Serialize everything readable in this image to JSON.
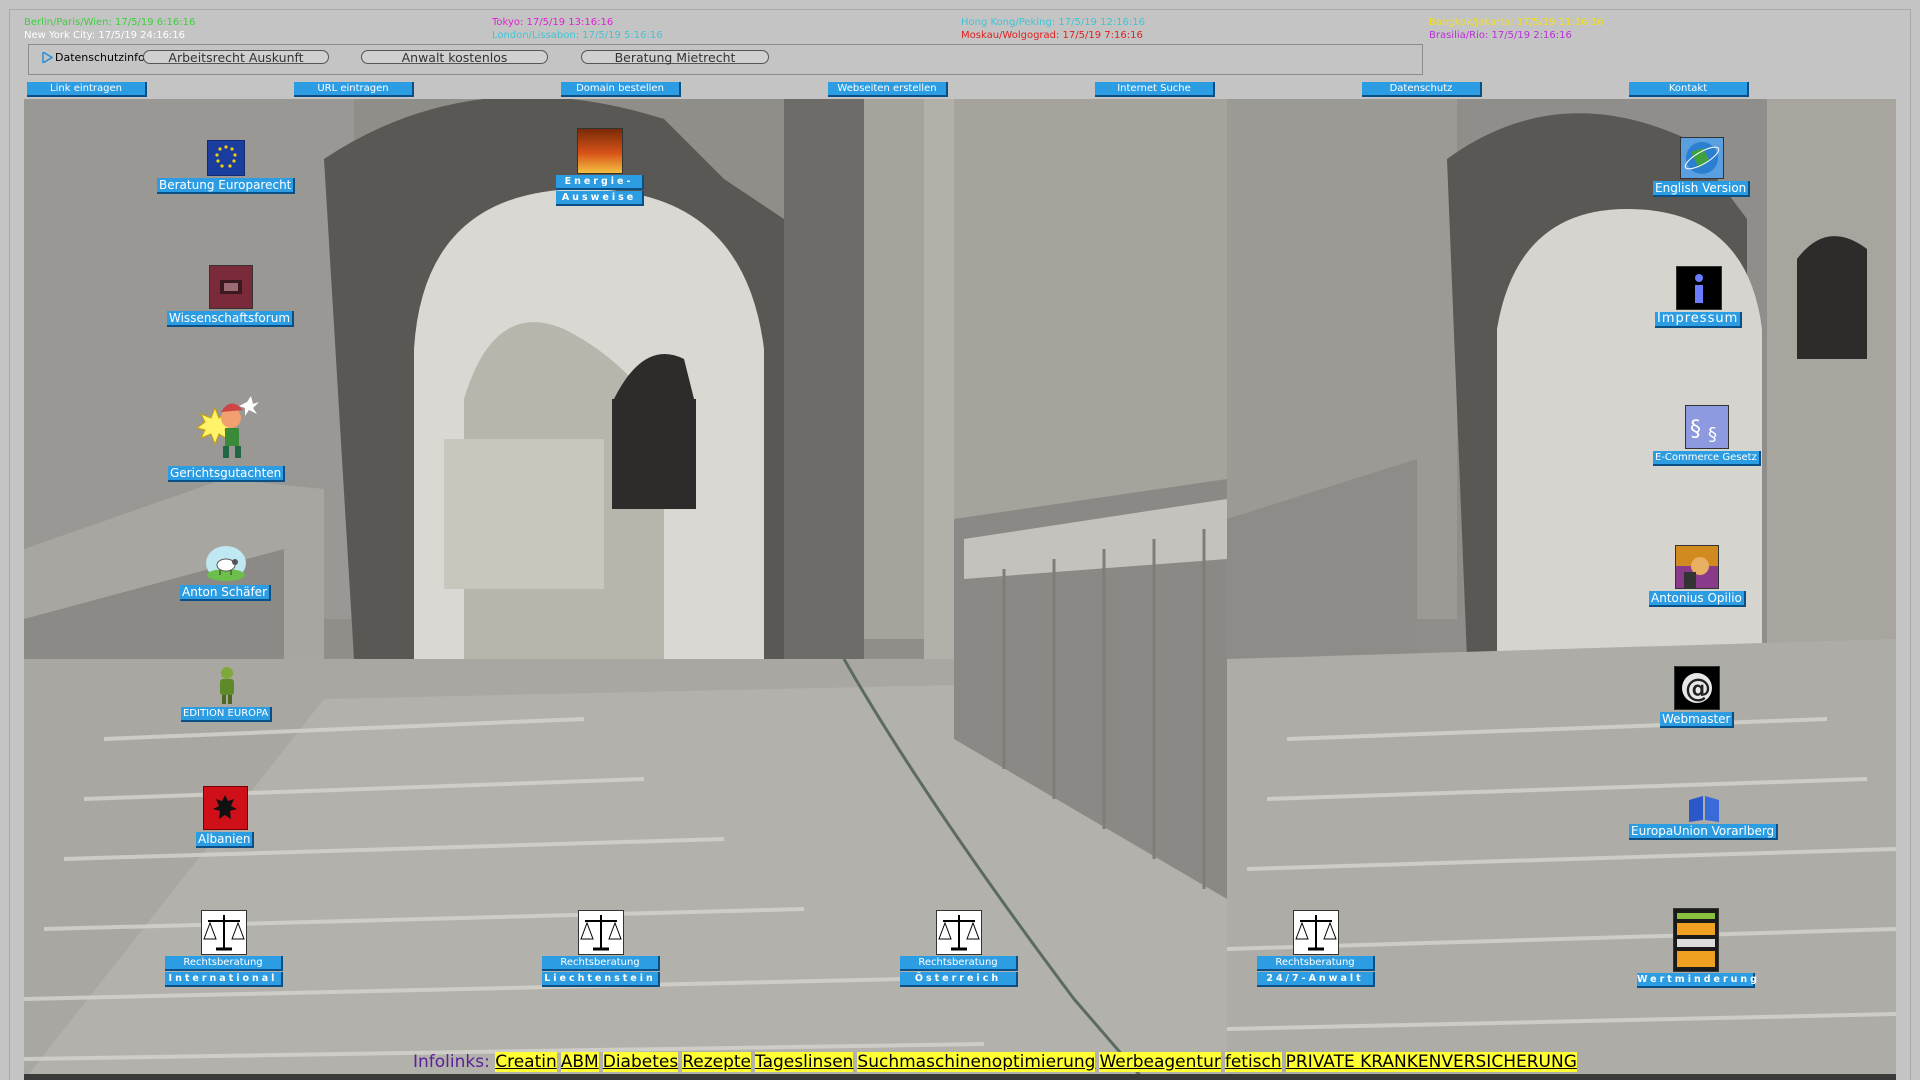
{
  "clocks": [
    {
      "text": "Berlin/Paris/Wien: 17/5/19 6:16:16",
      "color": "#3ecf3e"
    },
    {
      "text": "New York City: 17/5/19 24:16:16",
      "color": "#ffffff"
    },
    {
      "text": "Tokyo: 17/5/19 13:16:16",
      "color": "#e21fd6"
    },
    {
      "text": "London/Lissabon: 17/5/19 5:16:16",
      "color": "#3cc6d6"
    },
    {
      "text": "Hong Kong/Peking: 17/5/19 12:16:16",
      "color": "#3cc6d6"
    },
    {
      "text": "Moskau/Wolgograd: 17/5/19 7:16:16",
      "color": "#e21f1f"
    },
    {
      "text": "Bangkok/Jakarta: 17/5/19 11:16:16",
      "color": "#f0e020"
    },
    {
      "text": "Brasilia/Rio: 17/5/19 2:16:16",
      "color": "#b830d6"
    }
  ],
  "ad": {
    "privacy_label": "Datenschutzinfo",
    "pills": [
      "Arbeitsrecht Auskunft",
      "Anwalt kostenlos",
      "Beratung Mietrecht"
    ]
  },
  "nav": [
    "Link eintragen",
    "URL eintragen",
    "Domain bestellen",
    "Webseiten erstellen",
    "Internet Suche",
    "Datenschutz",
    "Kontakt"
  ],
  "left_icons": [
    {
      "label": "Beratung Europarecht",
      "icon": "eu-flag-icon"
    },
    {
      "label": "Wissenschaftsforum",
      "icon": "forum-icon"
    },
    {
      "label": "Gerichtsgutachten",
      "icon": "cartoon-figure-icon"
    },
    {
      "label": "Anton Schäfer",
      "icon": "sheep-icon"
    },
    {
      "label": "EDITION EUROPA",
      "icon": "figure-icon"
    },
    {
      "label": "Albanien",
      "icon": "albania-flag-icon"
    }
  ],
  "energy": {
    "line1": "Energie-",
    "line2": "Ausweise"
  },
  "right_icons": [
    {
      "label": "English Version",
      "icon": "globe-icon"
    },
    {
      "label": "Impressum",
      "icon": "info-icon"
    },
    {
      "label": "E-Commerce Gesetz",
      "icon": "paragraph-icon"
    },
    {
      "label": "Antonius Opilio",
      "icon": "portrait-icon"
    },
    {
      "label": "Webmaster",
      "icon": "at-sign-icon"
    },
    {
      "label": "EuropaUnion Vorarlberg",
      "icon": "book-icon"
    }
  ],
  "legal": [
    {
      "top": "Rechtsberatung",
      "bottom": "International"
    },
    {
      "top": "Rechtsberatung",
      "bottom": "Liechtenstein"
    },
    {
      "top": "Rechtsberatung",
      "bottom": "Österreich"
    },
    {
      "top": "Rechtsberatung",
      "bottom": "24/7-Anwalt"
    }
  ],
  "wertminderung": "Wertminderung",
  "infolinks": {
    "prefix": "Infolinks:",
    "links": [
      "Creatin",
      "ABM",
      "Diabetes",
      "Rezepte",
      "Tageslinsen",
      "Suchmaschinenoptimierung",
      "Werbeagentur",
      "fetisch",
      "PRIVATE KRANKENVERSICHERUNG"
    ]
  }
}
